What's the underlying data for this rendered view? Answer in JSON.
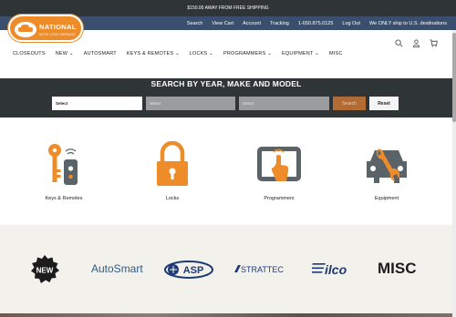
{
  "promo": {
    "text": "$150.00 AWAY FROM FREE SHIPPING"
  },
  "toplinks": [
    "Search",
    "View Cart",
    "Account",
    "Tracking",
    "1-650.875.0125",
    "Log Out",
    "We ONLY ship to U.S. destinations"
  ],
  "logo": {
    "name": "NATIONAL",
    "tagline": "AUTO LOCK SERVICE"
  },
  "nav": [
    "CLOSEOUTS",
    "NEW ⌄",
    "AUTOSMART",
    "KEYS & REMOTES ⌄",
    "LOCKS ⌄",
    "PROGRAMMERS ⌄",
    "EQUIPMENT ⌄",
    "MISC"
  ],
  "search": {
    "title": "SEARCH BY YEAR, MAKE AND MODEL",
    "selects": [
      "Select",
      "Select",
      "Select"
    ],
    "search_label": "Search",
    "reset_label": "Reset"
  },
  "categories": [
    "Keys & Remotes",
    "Locks",
    "Programmers",
    "Equipment"
  ],
  "brands": {
    "new": "NEW",
    "autosmart": "AutoSmart",
    "asp": "ASP",
    "strattec": "STRATTEC",
    "ilco": "ilco",
    "misc": "MISC"
  },
  "colors": {
    "accent": "#ef8c2a",
    "dark": "#2f3537",
    "topbar": "#3a4f6d",
    "icon_gray": "#5a6468"
  }
}
